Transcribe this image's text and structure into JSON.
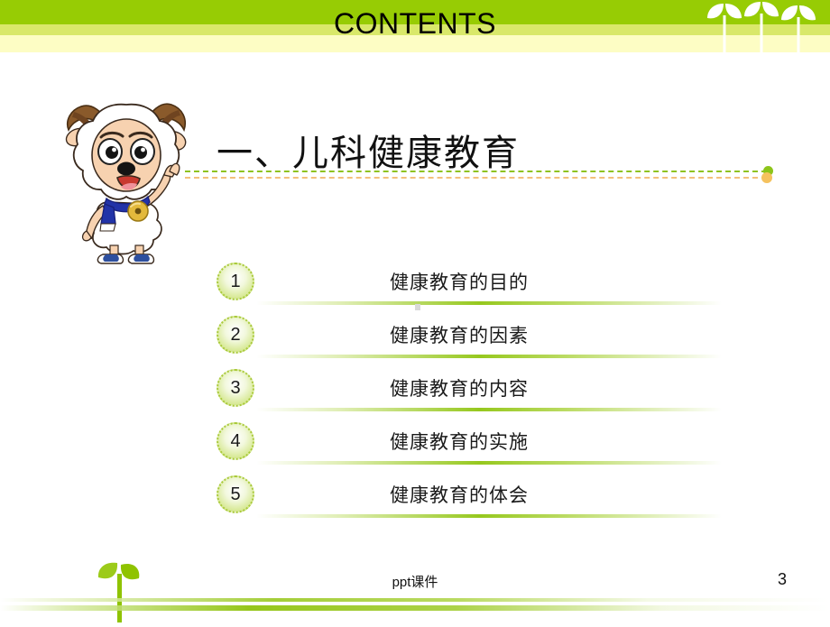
{
  "header": {
    "title": "CONTENTS",
    "band_colors": [
      "#97cc04",
      "#d9e86a",
      "#fdfdc4"
    ],
    "sprout_icon": "sprout-icon",
    "sprout_count": 3
  },
  "mascot": {
    "icon": "sheep-mascot-icon",
    "description": "cartoon sheep",
    "colors": {
      "wool": "#ffffff",
      "horn": "#8a5a2b",
      "skin": "#f7d2b0",
      "scarf": "#2233a8",
      "bell": "#e3b93c",
      "shoe": "#2d4f9e"
    }
  },
  "section": {
    "title": "一、儿科健康教育",
    "divider_green_color": "#8fc31f",
    "divider_orange_color": "#f3c07b"
  },
  "contents": {
    "items": [
      {
        "number": "1",
        "label": "健康教育的目的"
      },
      {
        "number": "2",
        "label": "健康教育的因素"
      },
      {
        "number": "3",
        "label": "健康教育的内容"
      },
      {
        "number": "4",
        "label": "健康教育的实施"
      },
      {
        "number": "5",
        "label": "健康教育的体会"
      }
    ],
    "accent_color": "#96c61c"
  },
  "footer": {
    "label": "ppt课件",
    "page_number": "3",
    "sprout_icon": "sprout-icon"
  }
}
